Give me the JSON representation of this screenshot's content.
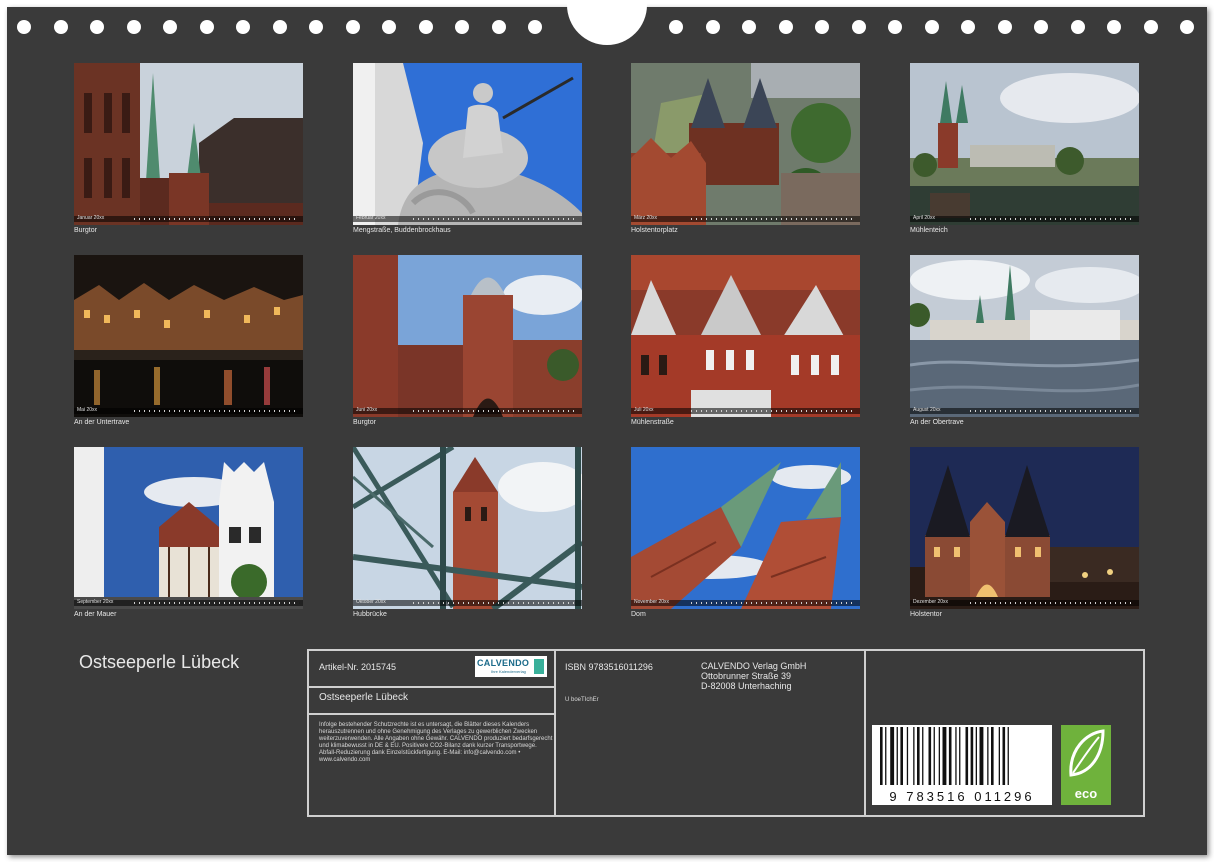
{
  "calendar": {
    "title": "Ostseeperle Lübeck",
    "months": [
      {
        "strip": "Januar 20xx",
        "caption": "Burgtor"
      },
      {
        "strip": "Februar 20xx",
        "caption": "Mengstraße, Buddenbrockhaus"
      },
      {
        "strip": "März 20xx",
        "caption": "Holstentorplatz"
      },
      {
        "strip": "April 20xx",
        "caption": "Mühlenteich"
      },
      {
        "strip": "Mai 20xx",
        "caption": "An der Untertrave"
      },
      {
        "strip": "Juni 20xx",
        "caption": "Burgtor"
      },
      {
        "strip": "Juli 20xx",
        "caption": "Mühlenstraße"
      },
      {
        "strip": "August 20xx",
        "caption": "An der Obertrave"
      },
      {
        "strip": "September 20xx",
        "caption": "An der Mauer"
      },
      {
        "strip": "Oktober 20xx",
        "caption": "Hubbrücke"
      },
      {
        "strip": "November 20xx",
        "caption": "Dom"
      },
      {
        "strip": "Dezember 20xx",
        "caption": "Holstentor"
      }
    ]
  },
  "info": {
    "article": "Artikel-Nr. 2015745",
    "logo": "CALVENDO",
    "logo_sub": "Ihre Kalenderverlag",
    "subtitle": "Ostseeperle Lübeck",
    "legal": "Infolge bestehender Schutzrechte ist es untersagt, die Blätter dieses Kalenders herauszutrennen und ohne Genehmigung des Verlages zu gewerblichen Zwecken weiterzuverwenden. Alle Angaben ohne Gewähr. CALVENDO produziert bedarfsgerecht und klimabewusst in DE & EU. Positivere CO2-Bilanz dank kurzer Transportwege. Abfall-Reduzierung dank Einzelstückfertigung. E-Mail: info@calvendo.com • www.calvendo.com",
    "isbn": "ISBN 9783516011296",
    "code": "U boeTIchEr",
    "publisher": [
      "CALVENDO Verlag GmbH",
      "Ottobrunner Straße 39",
      "D-82008 Unterhaching"
    ],
    "barcode_digits": "9 783516 011296",
    "eco_label": "eco"
  }
}
